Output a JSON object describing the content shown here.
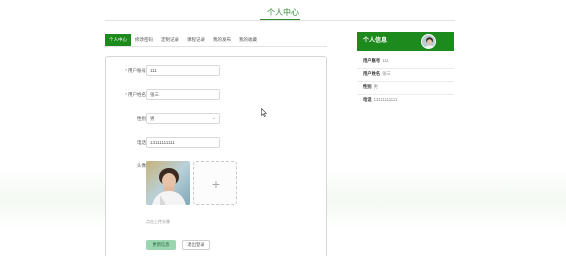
{
  "header": {
    "title": "个人中心"
  },
  "tabs": [
    {
      "label": "个人中心",
      "active": true
    },
    {
      "label": "修改密码",
      "active": false
    },
    {
      "label": "定制记录",
      "active": false
    },
    {
      "label": "课程记录",
      "active": false
    },
    {
      "label": "我的发布",
      "active": false
    },
    {
      "label": "我的收藏",
      "active": false
    }
  ],
  "form": {
    "account": {
      "label": "用户账号",
      "value": "111",
      "required": true
    },
    "name": {
      "label": "用户姓名",
      "value": "张三",
      "required": true
    },
    "gender": {
      "label": "性别",
      "value": "男"
    },
    "phone": {
      "label": "电话",
      "value": "13111111111"
    },
    "avatar": {
      "label": "头像",
      "upload_icon": "plus-icon"
    },
    "hint": "点击上传头像",
    "update_button": "更新信息",
    "logout_button": "退出登录"
  },
  "profile_card": {
    "title": "个人信息",
    "rows": [
      {
        "key": "用户账号",
        "value": "111"
      },
      {
        "key": "用户姓名",
        "value": "张三"
      },
      {
        "key": "性别",
        "value": "男"
      },
      {
        "key": "电话",
        "value": "13111111111"
      }
    ]
  },
  "colors": {
    "accent": "#1c8a1c",
    "title": "#2d8a2d",
    "update_button_bg": "#9bd6b0"
  }
}
